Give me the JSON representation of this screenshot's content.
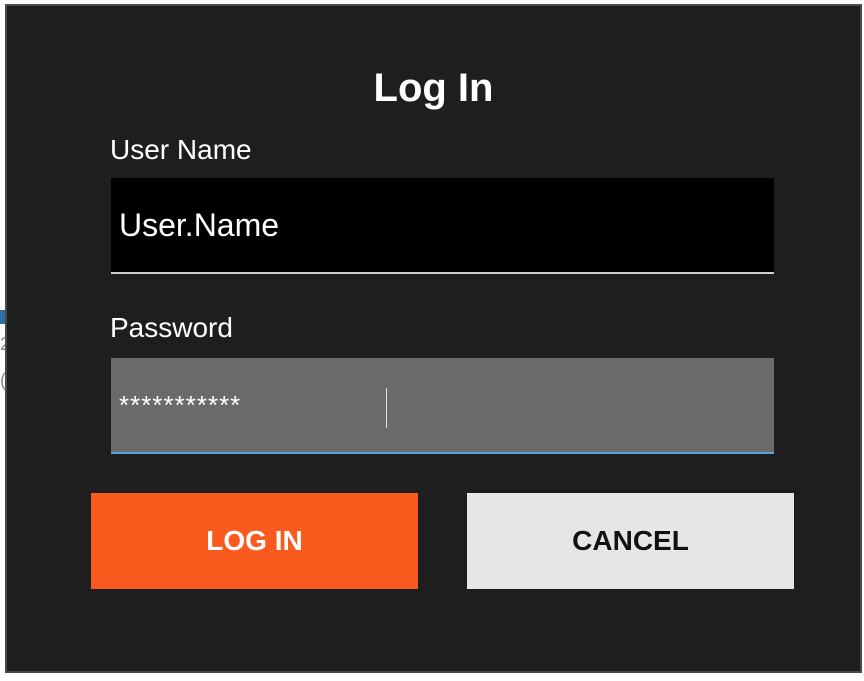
{
  "dialog": {
    "title": "Log In",
    "username": {
      "label": "User Name",
      "value": "User.Name"
    },
    "password": {
      "label": "Password",
      "value": "***********"
    },
    "buttons": {
      "login_label": "LOG IN",
      "cancel_label": "CANCEL"
    }
  },
  "background_fragments": {
    "glyph_a": "2",
    "glyph_b": "("
  },
  "colors": {
    "dialog_bg": "#1e1e1e",
    "login_button": "#fa5a1e",
    "cancel_button": "#e6e6e6",
    "password_focus_underline": "#5aa0e0"
  }
}
